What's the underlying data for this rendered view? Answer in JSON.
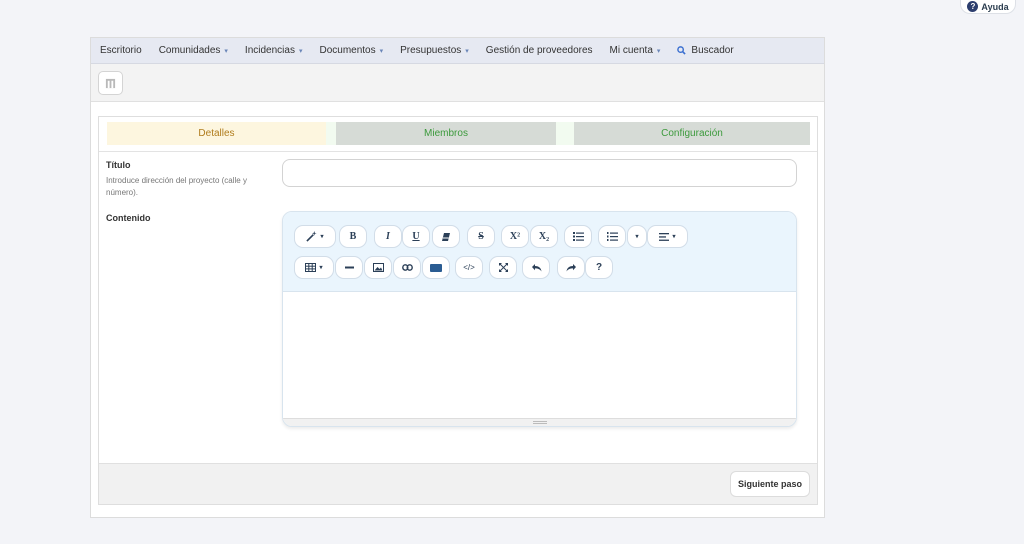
{
  "help": {
    "label": "Ayuda",
    "icon": "question-icon",
    "glyph": "?"
  },
  "nav": {
    "escritorio": "Escritorio",
    "comunidades": "Comunidades",
    "incidencias": "Incidencias",
    "documentos": "Documentos",
    "presupuestos": "Presupuestos",
    "proveedores": "Gestión de proveedores",
    "cuenta": "Mi cuenta",
    "buscador": "Buscador",
    "caret": "▾"
  },
  "steps": {
    "detalles": "Detalles",
    "miembros": "Miembros",
    "configuracion": "Configuración"
  },
  "form": {
    "titulo_label": "Título",
    "titulo_hint": "Introduce dirección del proyecto (calle y número).",
    "titulo_value": "",
    "contenido_label": "Contenido"
  },
  "toolbar": {
    "bold": "B",
    "italic": "I",
    "underline": "U",
    "strike": "S",
    "sup": "X²",
    "sub": "X₂",
    "help": "?",
    "code": "</>",
    "caret": "▾"
  },
  "footer": {
    "next_label": "Siguiente paso"
  },
  "colors": {
    "nav_bg": "#e6e9f2",
    "active_step": "#b07c1c",
    "pending_step": "#3c9a3c",
    "toolbar_bg": "#eaf5fd"
  }
}
